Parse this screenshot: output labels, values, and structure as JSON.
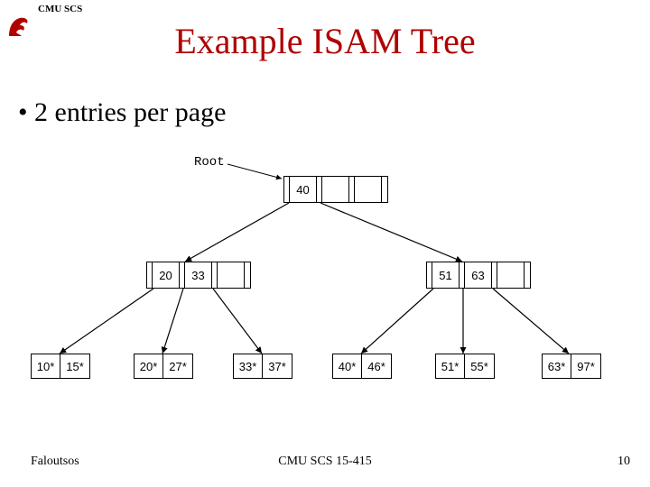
{
  "header": {
    "org": "CMU SCS"
  },
  "title": "Example ISAM Tree",
  "bullet": "2 entries per page",
  "labels": {
    "root": "Root"
  },
  "tree": {
    "root": {
      "keys": [
        "40",
        "",
        ""
      ]
    },
    "internal": [
      {
        "keys": [
          "20",
          "33",
          ""
        ]
      },
      {
        "keys": [
          "51",
          "63",
          ""
        ]
      }
    ],
    "leaves": [
      {
        "cells": [
          "10*",
          "15*"
        ]
      },
      {
        "cells": [
          "20*",
          "27*"
        ]
      },
      {
        "cells": [
          "33*",
          "37*"
        ]
      },
      {
        "cells": [
          "40*",
          "46*"
        ]
      },
      {
        "cells": [
          "51*",
          "55*"
        ]
      },
      {
        "cells": [
          "63*",
          "97*"
        ]
      }
    ]
  },
  "footer": {
    "left": "Faloutsos",
    "center": "CMU SCS 15-415",
    "right": "10"
  },
  "colors": {
    "title": "#b00000"
  }
}
